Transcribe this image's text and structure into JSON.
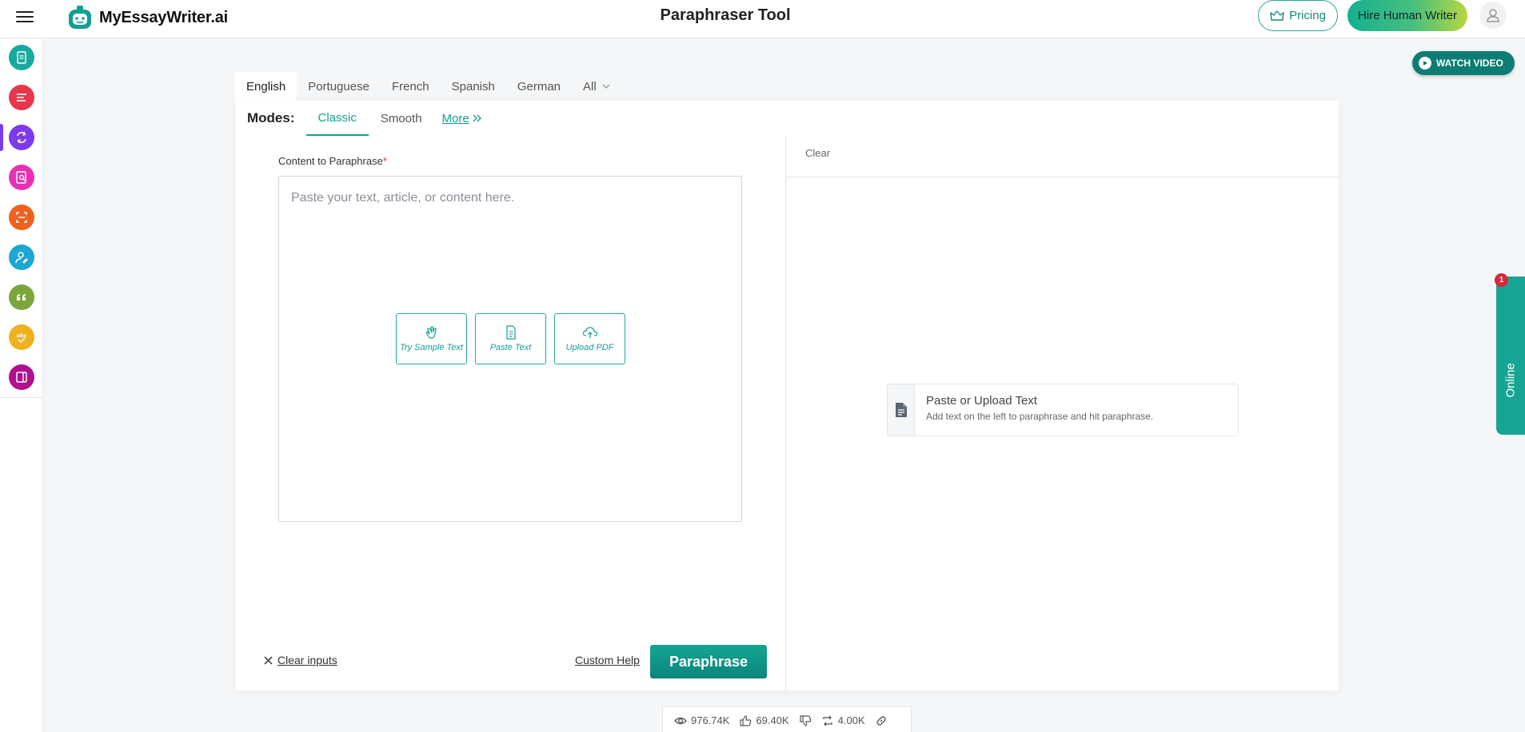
{
  "app": {
    "brand": "MyEssayWriter.ai",
    "page_title": "Paraphraser Tool"
  },
  "header": {
    "pricing_label": "Pricing",
    "hire_label": "Hire Human Writer"
  },
  "watch_video": "WATCH VIDEO",
  "languages": {
    "tabs": [
      "English",
      "Portuguese",
      "French",
      "Spanish",
      "German"
    ],
    "all_label": "All",
    "active": "English"
  },
  "modes": {
    "label": "Modes:",
    "tabs": [
      "Classic",
      "Smooth"
    ],
    "more_label": "More",
    "active": "Classic"
  },
  "input": {
    "label": "Content to Paraphrase",
    "required_mark": "*",
    "placeholder": "Paste your text, article, or content here.",
    "actions": {
      "sample": "Try Sample Text",
      "paste": "Paste Text",
      "upload": "Upload PDF"
    },
    "clear_label": "Clear inputs",
    "custom_help": "Custom Help",
    "submit": "Paraphrase"
  },
  "output": {
    "clear_label": "Clear",
    "empty_title": "Paste or Upload Text",
    "empty_sub": "Add text on the left to paraphrase and hit paraphrase."
  },
  "stats": {
    "views": "976.74K",
    "likes": "69.40K",
    "shares": "4.00K"
  },
  "chat": {
    "label": "Online",
    "badge": "1"
  },
  "colors": {
    "accent": "#13a091",
    "sidebar_icons": [
      "#18a99d",
      "#e8364b",
      "#7c3aed",
      "#e830b4",
      "#f0601e",
      "#1ca6d4",
      "#7aa63b",
      "#f0b120",
      "#b0108e"
    ]
  }
}
